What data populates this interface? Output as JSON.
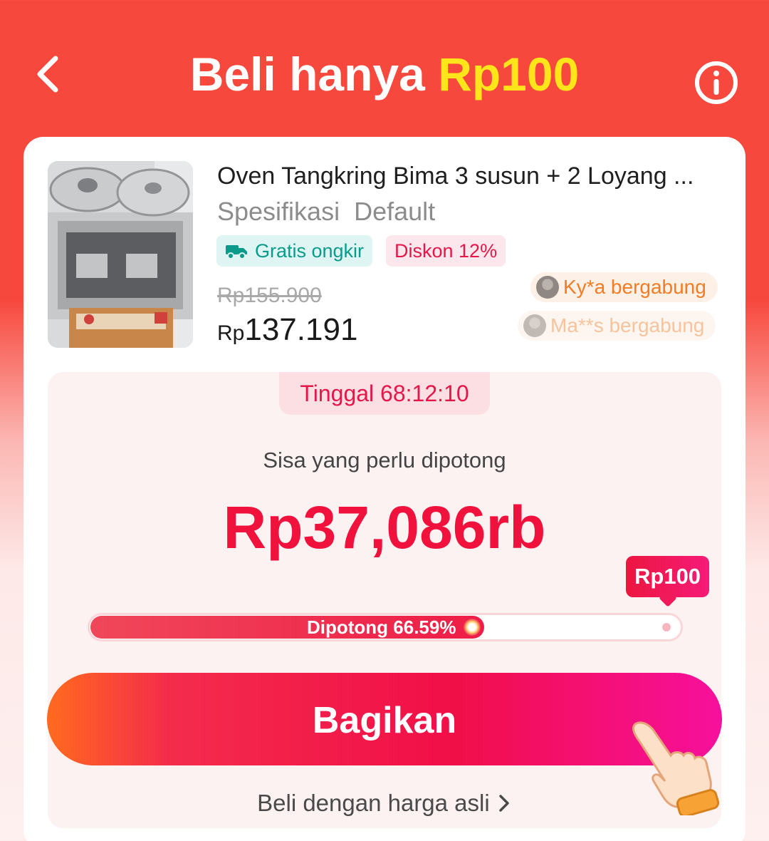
{
  "header": {
    "title_main": "Beli hanya",
    "title_accent": "Rp100",
    "back_icon": "chevron-left-icon",
    "info_icon": "info-circle-icon"
  },
  "product": {
    "title": "Oven Tangkring Bima 3 susun + 2 Loyang ...",
    "spec": "Spesifikasi  Default",
    "free_shipping_tag": "Gratis ongkir",
    "discount_tag": "Diskon 12%",
    "original_price": "Rp155.900",
    "price_currency": "Rp",
    "price_value": "137.191"
  },
  "joiners": [
    {
      "text": "Ky*a bergabung"
    },
    {
      "text": "Ma**s bergabung"
    }
  ],
  "progress": {
    "timer": "Tinggal 68:12:10",
    "remaining_label": "Sisa yang perlu dipotong",
    "remaining_value": "Rp37,086rb",
    "cut_label": "Dipotong 66.59%",
    "cut_percent": 66.59,
    "target_label": "Rp100"
  },
  "actions": {
    "share_label": "Bagikan",
    "buy_original_label": "Beli dengan harga asli"
  },
  "colors": {
    "header_red": "#f7483d",
    "accent_yellow": "#ffe51a",
    "price_red": "#f0113c",
    "free_shipping_green": "#0a9b8b",
    "joiner_orange": "#f37b22"
  }
}
